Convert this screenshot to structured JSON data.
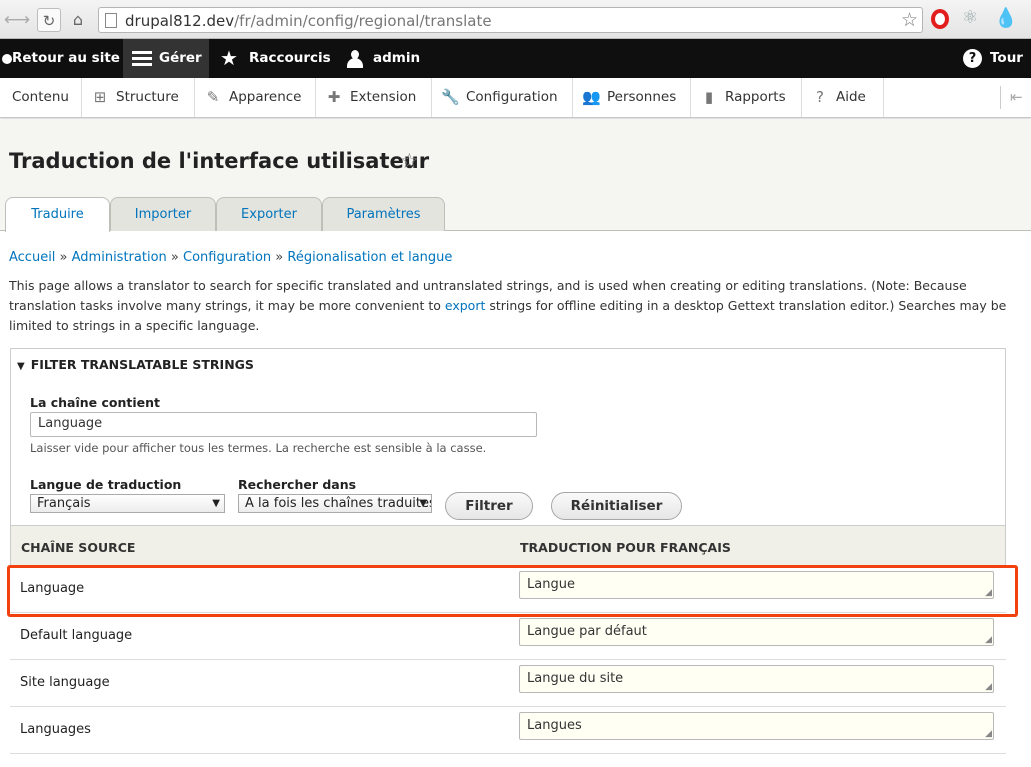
{
  "browser": {
    "url_host": "drupal812.dev",
    "url_path": "/fr/admin/config/regional/translate"
  },
  "toolbar": {
    "back_label": "Retour au site",
    "manage_label": "Gérer",
    "shortcuts_label": "Raccourcis",
    "user_label": "admin",
    "tour_label": "Tour"
  },
  "tray": {
    "items": [
      {
        "label": "Contenu"
      },
      {
        "label": "Structure"
      },
      {
        "label": "Apparence"
      },
      {
        "label": "Extension"
      },
      {
        "label": "Configuration"
      },
      {
        "label": "Personnes"
      },
      {
        "label": "Rapports"
      },
      {
        "label": "Aide"
      }
    ]
  },
  "page": {
    "title": "Traduction de l'interface utilisateur",
    "tabs": [
      {
        "label": "Traduire",
        "active": true
      },
      {
        "label": "Importer"
      },
      {
        "label": "Exporter"
      },
      {
        "label": "Paramètres"
      }
    ]
  },
  "breadcrumb": [
    "Accueil",
    "Administration",
    "Configuration",
    "Régionalisation et langue"
  ],
  "intro": {
    "text_before": "This page allows a translator to search for specific translated and untranslated strings, and is used when creating or editing translations. (Note: Because translation tasks involve many strings, it may be more convenient to ",
    "link": "export",
    "text_after": " strings for offline editing in a desktop Gettext translation editor.) Searches may be limited to strings in a specific language."
  },
  "filter": {
    "legend": "FILTER TRANSLATABLE STRINGS",
    "contains_label": "La chaîne contient",
    "contains_value": "Language",
    "contains_help": "Laisser vide pour afficher tous les termes. La recherche est sensible à la casse.",
    "langcode_label": "Langue de traduction",
    "langcode_value": "Français",
    "search_in_label": "Rechercher dans",
    "search_in_value": "A la fois les chaînes traduites et non traduites",
    "filter_button": "Filtrer",
    "reset_button": "Réinitialiser"
  },
  "table": {
    "headers": [
      "CHAÎNE SOURCE",
      "TRADUCTION POUR FRANÇAIS"
    ],
    "rows": [
      {
        "source": "Language",
        "translation": "Langue"
      },
      {
        "source": "Default language",
        "translation": "Langue par défaut"
      },
      {
        "source": "Site language",
        "translation": "Langue du site"
      },
      {
        "source": "Languages",
        "translation": "Langues"
      }
    ]
  },
  "colors": {
    "toolbar_bg": "#0f0f0f",
    "link": "#0074bd",
    "highlight": "#f2410f"
  }
}
